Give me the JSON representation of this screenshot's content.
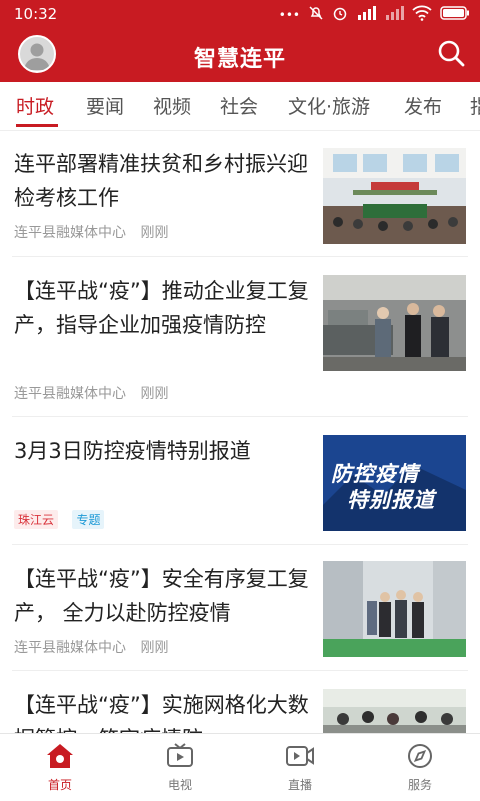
{
  "status_bar": {
    "time": "10:32",
    "icons": [
      "more-dots-icon",
      "mute-icon",
      "alarm-icon",
      "signal-hd-icon",
      "signal-icon",
      "wifi-icon",
      "battery-icon"
    ]
  },
  "header": {
    "title": "智慧连平"
  },
  "tabs": [
    {
      "label": "时政",
      "active": true
    },
    {
      "label": "要闻"
    },
    {
      "label": "视频"
    },
    {
      "label": "社会"
    },
    {
      "label": "文化·旅游"
    },
    {
      "label": "发布"
    },
    {
      "label": "指"
    }
  ],
  "news": [
    {
      "title": "连平部署精准扶贫和乡村振兴迎检考核工作",
      "source": "连平县融媒体中心",
      "time": "刚刚"
    },
    {
      "title": "【连平战“疫”】推动企业复工复产，指导企业加强疫情防控",
      "source": "连平县融媒体中心",
      "time": "刚刚"
    },
    {
      "title": "3月3日防控疫情特别报道",
      "tags": [
        "珠江云",
        "专题"
      ],
      "thumb_text": [
        "防控疫情",
        "特别报道"
      ]
    },
    {
      "title": "【连平战“疫”】安全有序复工复产， 全力以赴防控疫情",
      "source": "连平县融媒体中心",
      "time": "刚刚"
    },
    {
      "title": "【连平战“疫”】实施网格化大数据管控，筑牢疫情防"
    }
  ],
  "bottom_nav": [
    {
      "label": "首页",
      "active": true
    },
    {
      "label": "电视"
    },
    {
      "label": "直播"
    },
    {
      "label": "服务"
    }
  ],
  "colors": {
    "brand": "#c81b22"
  }
}
